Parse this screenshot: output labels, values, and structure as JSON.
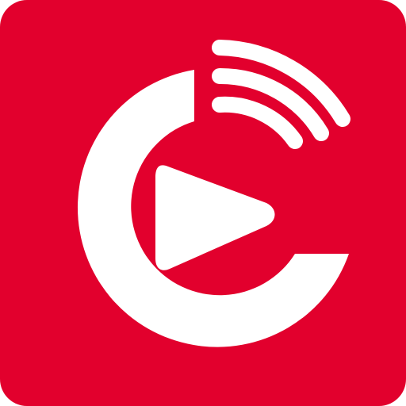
{
  "app_icon": {
    "name": "broadcast-play-app-icon",
    "background_color": "#E2002D",
    "foreground_color": "#FFFFFF",
    "icons": [
      "c-ring-icon",
      "play-icon",
      "broadcast-waves-icon"
    ]
  }
}
